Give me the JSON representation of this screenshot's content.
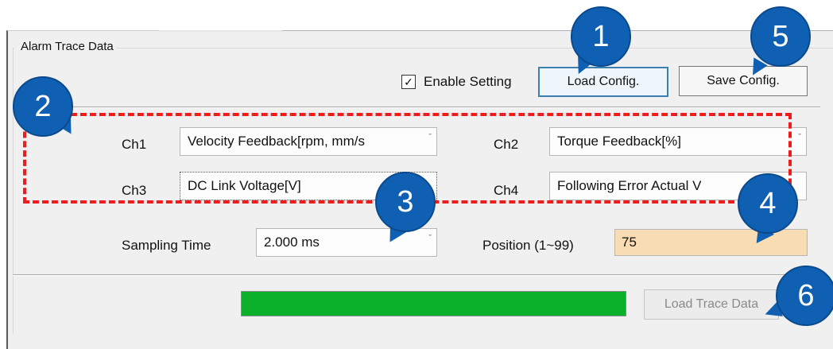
{
  "group": {
    "title": "Alarm Trace Data"
  },
  "toolbar": {
    "enable_setting_label": "Enable Setting",
    "enable_setting_checked": true,
    "load_config_label": "Load Config.",
    "save_config_label": "Save Config."
  },
  "channels": {
    "ch1": {
      "label": "Ch1",
      "value": "Velocity Feedback[rpm, mm/s"
    },
    "ch2": {
      "label": "Ch2",
      "value": "Torque Feedback[%]"
    },
    "ch3": {
      "label": "Ch3",
      "value": "DC Link Voltage[V]"
    },
    "ch4": {
      "label": "Ch4",
      "value": "Following Error Actual V"
    }
  },
  "sampling": {
    "label": "Sampling Time",
    "value": "2.000 ms"
  },
  "position": {
    "label": "Position (1~99)",
    "value": "75"
  },
  "progress": {
    "fraction": 1.0,
    "color": "#0aaf2a"
  },
  "load_trace": {
    "label": "Load Trace Data"
  },
  "markers": [
    "1",
    "2",
    "3",
    "4",
    "5",
    "6"
  ],
  "colors": {
    "marker": "#0f5fb3",
    "highlight_dash": "#ee1c1c",
    "position_bg": "#f8dcb4"
  }
}
